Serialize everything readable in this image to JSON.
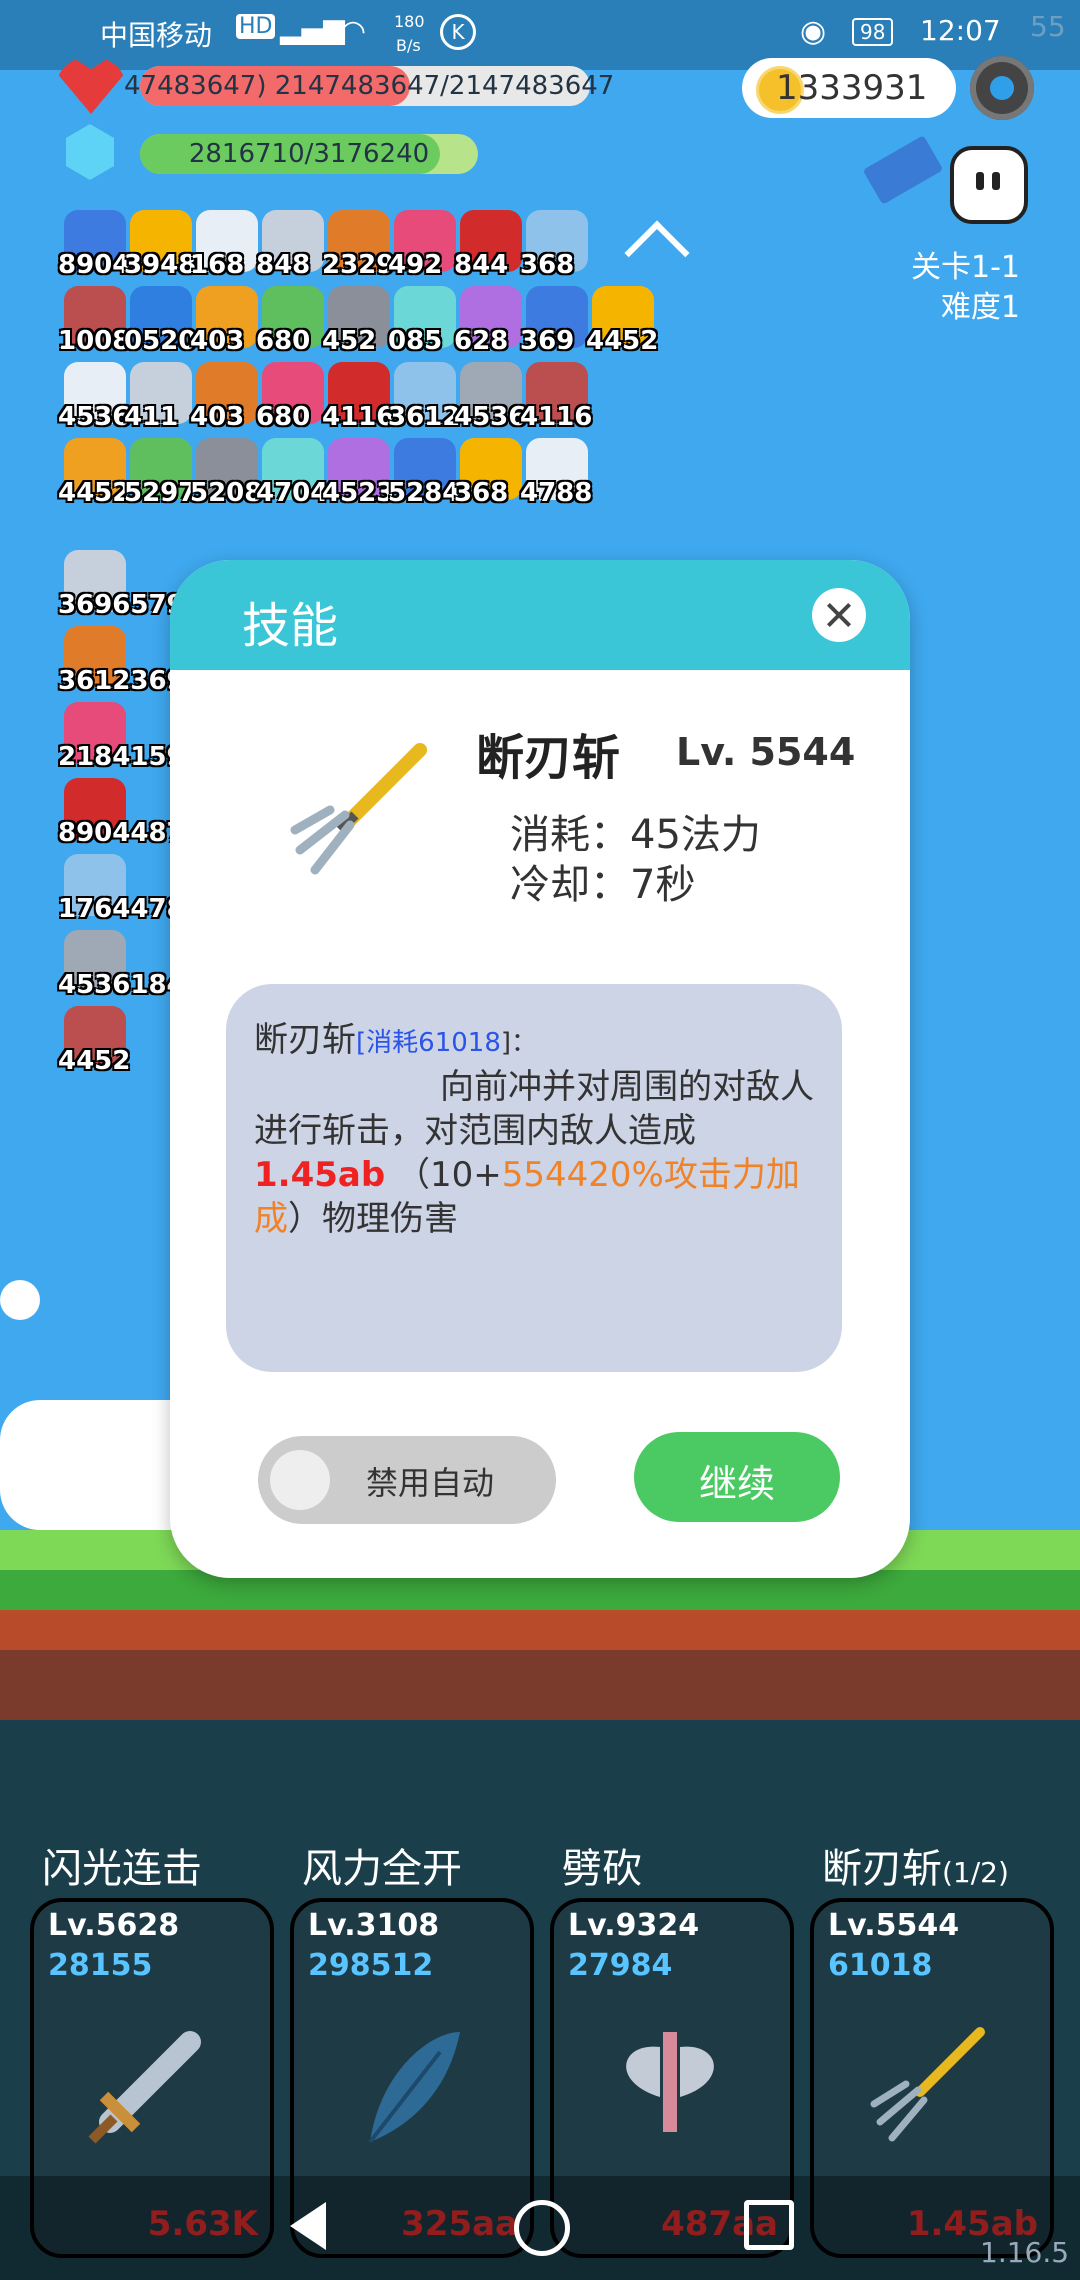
{
  "status": {
    "carrier": "中国移动",
    "speed_top": "180",
    "speed_unit": "B/s",
    "battery": "98",
    "time": "12:07",
    "corner": "55"
  },
  "hud": {
    "hp_text": "47483647) 2147483647/2147483647",
    "mp_text": "2816710/3176240",
    "hp_fraction": 0.6,
    "mp_fraction": 0.89,
    "gold": "1333931"
  },
  "stage": {
    "level": "关卡1-1",
    "difficulty": "难度1"
  },
  "items": {
    "row1": [
      "8904",
      "3948",
      "168",
      "848",
      "2329",
      "492",
      "844",
      "368"
    ],
    "row2": [
      "1008",
      "0520",
      "403",
      "680",
      "452",
      "085",
      "628",
      "369",
      "4452"
    ],
    "row3": [
      "4536",
      "411",
      "403",
      "680",
      "4116",
      "3612",
      "4536",
      "4116"
    ],
    "row4": [
      "4452",
      "5297",
      "5208",
      "4704",
      "4523",
      "5284",
      "368",
      "4788"
    ],
    "col": [
      "3696579",
      "3612369",
      "2184159",
      "8904487",
      "1764478",
      "4536184",
      "4452"
    ]
  },
  "dialog": {
    "title": "技能",
    "skill_name": "断刃斩",
    "skill_level": "Lv. 5544",
    "cost": "消耗：45法力",
    "cooldown": "冷却：7秒",
    "desc_name": "断刃斩",
    "desc_cost_open": "[",
    "desc_cost": "消耗61018",
    "desc_cost_close": "]：",
    "desc_text1": "向前冲并对周围的对敌人进行斩击，对范围内敌人造成",
    "desc_damage": "1.45ab",
    "desc_text2": "（10+",
    "desc_bonus": "554420%攻击力加成",
    "desc_text3": "）物理伤害",
    "toggle_label": "禁用自动",
    "toggle_on": false,
    "continue_label": "继续"
  },
  "skills": [
    {
      "title": "闪光连击",
      "lv": "Lv.5628",
      "cost": "28155",
      "damage": "5.63K",
      "icon": "sword-icon"
    },
    {
      "title": "风力全开",
      "lv": "Lv.3108",
      "cost": "298512",
      "damage": "325aa",
      "icon": "feather-icon"
    },
    {
      "title": "劈砍",
      "lv": "Lv.9324",
      "cost": "27984",
      "damage": "487aa",
      "icon": "axe-icon"
    },
    {
      "title": "断刃斩",
      "title_suffix": "(1/2)",
      "lv": "Lv.5544",
      "cost": "61018",
      "damage": "1.45ab",
      "icon": "trident-icon"
    }
  ],
  "version": "1.16.5"
}
